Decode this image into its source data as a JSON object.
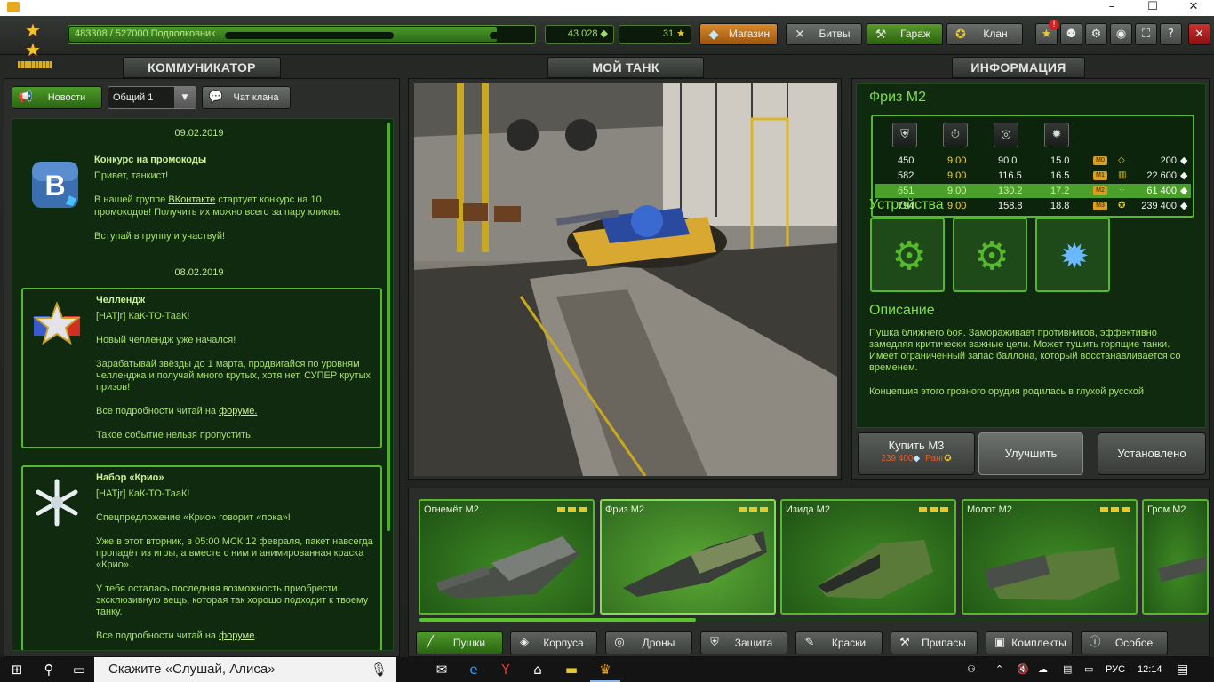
{
  "window": {
    "minimize": "–",
    "maximize": "☐",
    "close": "✕"
  },
  "topbar": {
    "xp_text": "483308 / 527000  Подполковник",
    "xp_progress": 0.917,
    "crystals": "43 028",
    "stars": "31",
    "buttons": [
      {
        "label": "Магазин",
        "icon": "crystal-icon"
      },
      {
        "label": "Битвы",
        "icon": "crossed-guns-icon"
      },
      {
        "label": "Гараж",
        "icon": "tools-icon"
      },
      {
        "label": "Клан",
        "icon": "medal-icon"
      }
    ]
  },
  "sections": {
    "left": "КОММУНИКАТОР",
    "center": "МОЙ ТАНК",
    "right": "ИНФОРМАЦИЯ"
  },
  "communicator": {
    "tabs": {
      "news": "Новости",
      "channel": "Общий 1",
      "clan_chat": "Чат клана"
    },
    "news": [
      {
        "date": "09.02.2019",
        "title": "Конкурс на промокоды",
        "lines": [
          {
            "text": "Привет, танкист!"
          },
          {
            "pre": "В нашей группе ",
            "link": "ВКонтакте",
            "post": "  стартует конкурс на 10"
          },
          {
            "text": "промокодов! Получить их можно всего за пару кликов."
          },
          {
            "text": "Вступай в группу и участвуй!"
          }
        ]
      },
      {
        "date": "08.02.2019",
        "title": "Челлендж",
        "lines": [
          {
            "text": "[HATjr] КаК-ТО-ТааК!"
          },
          {
            "text": "Новый челлендж уже начался!"
          },
          {
            "text": "Зарабатывай звёзды до 1 марта, продвигайся по уровням"
          },
          {
            "text": "челленджа и получай много крутых, хотя нет, СУПЕР крутых"
          },
          {
            "text": "призов!"
          },
          {
            "pre": "Все подробности читай на  ",
            "link": "форуме.",
            "post": ""
          },
          {
            "text": "Такое событие нельзя пропустить!"
          }
        ]
      },
      {
        "title": "Набор «Крио»",
        "lines": [
          {
            "text": "[HATjr] КаК-ТО-ТааК!"
          },
          {
            "text": "Спецпредложение «Крио» говорит «пока»!"
          },
          {
            "text": "Уже в этот вторник, в 05:00 МСК 12 февраля, пакет навсегда"
          },
          {
            "text": "пропадёт из игры, а вместе с ним и анимированная краска"
          },
          {
            "text": "«Крио»."
          },
          {
            "text": "У тебя осталась последняя возможность приобрести"
          },
          {
            "text": "эксклюзивную вещь, которая так хорошо подходит к твоему"
          },
          {
            "text": "танку."
          },
          {
            "pre": "Все подробности читай на ",
            "link": "форуме",
            "post": "."
          }
        ]
      }
    ]
  },
  "info": {
    "title": "Фриз M2",
    "stat_icons": [
      "armor-icon",
      "reload-icon",
      "range-icon",
      "damage-icon"
    ],
    "rows": [
      {
        "v1": "450",
        "v2": "9.00",
        "v3": "90.0",
        "v4": "15.0",
        "mod": "M0",
        "price": "200"
      },
      {
        "v1": "582",
        "v2": "9.00",
        "v3": "116.5",
        "v4": "16.5",
        "mod": "M1",
        "price": "22 600"
      },
      {
        "v1": "651",
        "v2": "9.00",
        "v3": "130.2",
        "v4": "17.2",
        "mod": "M2",
        "price": "61 400"
      },
      {
        "v1": "794",
        "v2": "9.00",
        "v3": "158.8",
        "v4": "18.8",
        "mod": "M3",
        "price": "239 400"
      }
    ],
    "devices_title": "Устройства",
    "description_title": "Описание",
    "description": [
      "Пушка ближнего боя. Замораживает противников, эффективно",
      "замедляя критически важные цели. Может тушить горящие танки.",
      "Имеет ограниченный запас баллона, который восстанавливается со",
      "временем.",
      "",
      "Концепция этого грозного орудия родилась в глухой русской"
    ],
    "buy": {
      "label": "Купить M3",
      "price": "239 400",
      "rank": "Ранг"
    },
    "upgrade": "Улучшить",
    "installed": "Установлено"
  },
  "garage": {
    "items": [
      "Огнемёт M2",
      "Фриз M2",
      "Изида M2",
      "Молот M2",
      "Гром M2"
    ],
    "scroll_progress": 0.35,
    "categories": [
      "Пушки",
      "Корпуса",
      "Дроны",
      "Защита",
      "Краски",
      "Припасы",
      "Комплекты",
      "Особое"
    ]
  },
  "taskbar": {
    "search": "Скажите «Слушай, Алиса»",
    "lang": "РУС",
    "time": "12:14"
  }
}
